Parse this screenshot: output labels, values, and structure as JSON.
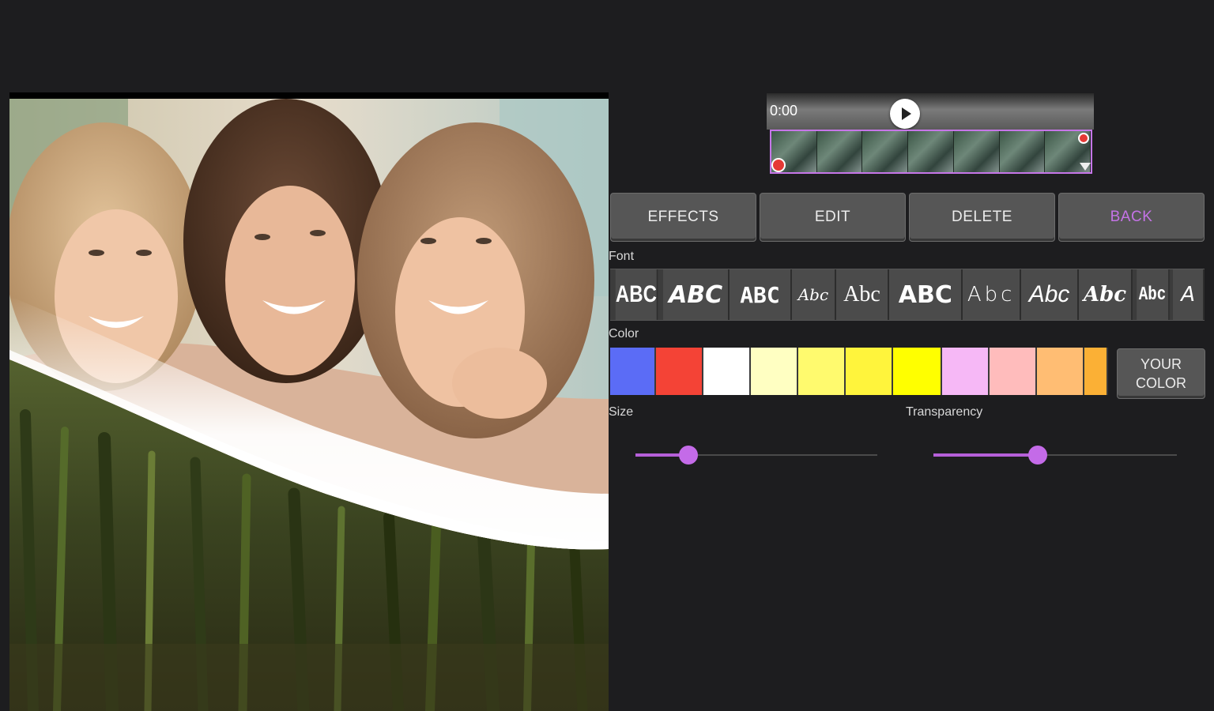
{
  "timeline": {
    "time": "0:00"
  },
  "actions": {
    "effects": "EFFECTS",
    "edit": "EDIT",
    "delete": "DELETE",
    "back": "BACK"
  },
  "labels": {
    "font": "Font",
    "color": "Color",
    "size": "Size",
    "transparency": "Transparency"
  },
  "fonts": [
    "ABC",
    "ABC",
    "ABC",
    "Abc",
    "Abc",
    "ABC",
    "Abc",
    "Abc",
    "Abc",
    "Abc",
    "A"
  ],
  "colors": [
    "#5b6cf6",
    "#f44336",
    "#ffffff",
    "#ffffc2",
    "#fffa6e",
    "#fff43c",
    "#ffff00",
    "#f6b8f6",
    "#ffbcbc",
    "#ffbd73",
    "#fbb035"
  ],
  "your_color": {
    "line1": "YOUR",
    "line2": "COLOR"
  },
  "sliders": {
    "size_fraction": 0.22,
    "transparency_fraction": 0.43
  },
  "theme": {
    "accent": "#c46be8",
    "background": "#1d1d1f"
  }
}
